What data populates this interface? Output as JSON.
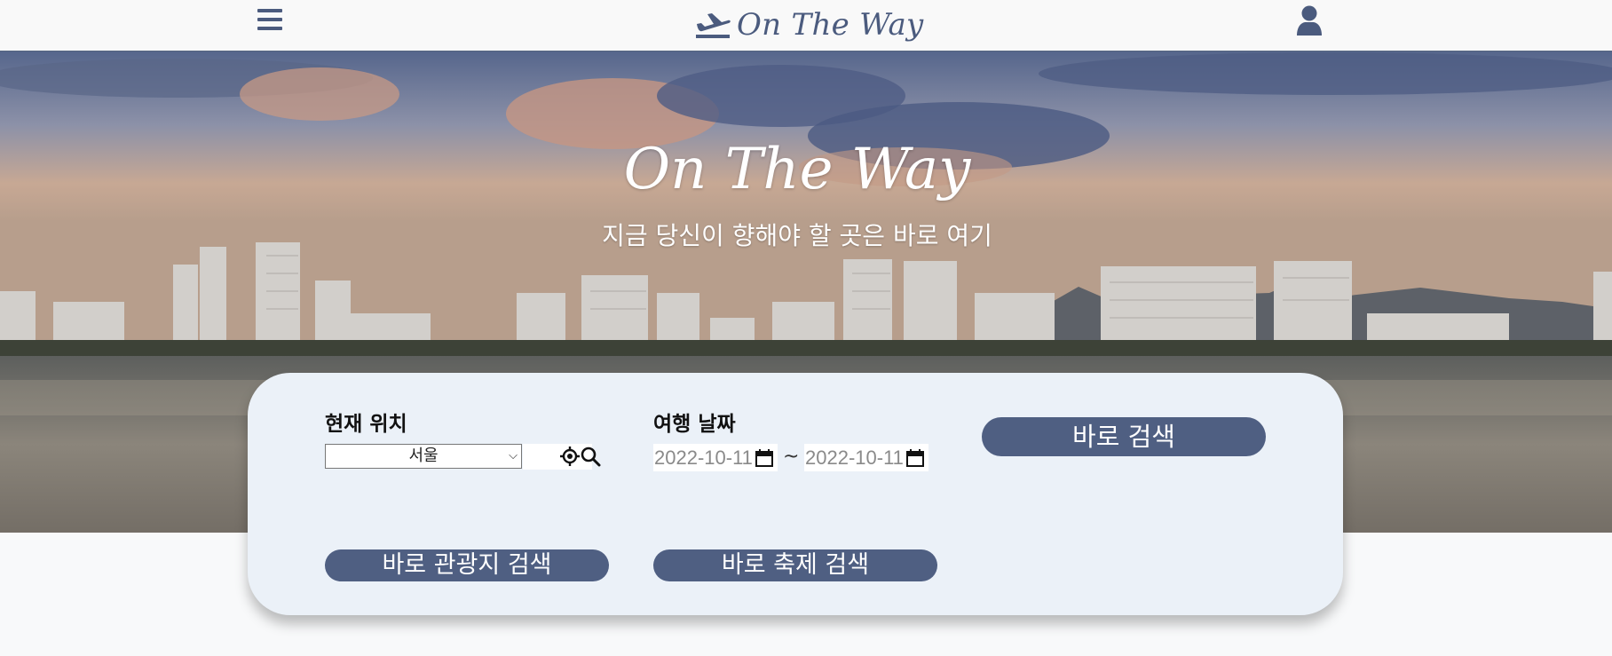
{
  "navbar": {
    "brand": "On The Way",
    "icons": [
      "menu-icon",
      "airplane-departure-icon",
      "user-icon"
    ]
  },
  "hero": {
    "title": "On The Way",
    "subtitle": "지금 당신이 향해야 할 곳은 바로 여기"
  },
  "search": {
    "location_label": "현재 위치",
    "location_value": "서울",
    "date_label": "여행 날짜",
    "date_start": "2022-10-11",
    "date_end": "2022-10-11",
    "date_separator": "~",
    "search_button": "바로 검색",
    "tour_button": "바로 관광지 검색",
    "festival_button": "바로 축제 검색"
  },
  "colors": {
    "accent": "#4f5f82",
    "panel": "#ebf1f8",
    "nav_background": "#f9f9f9"
  }
}
